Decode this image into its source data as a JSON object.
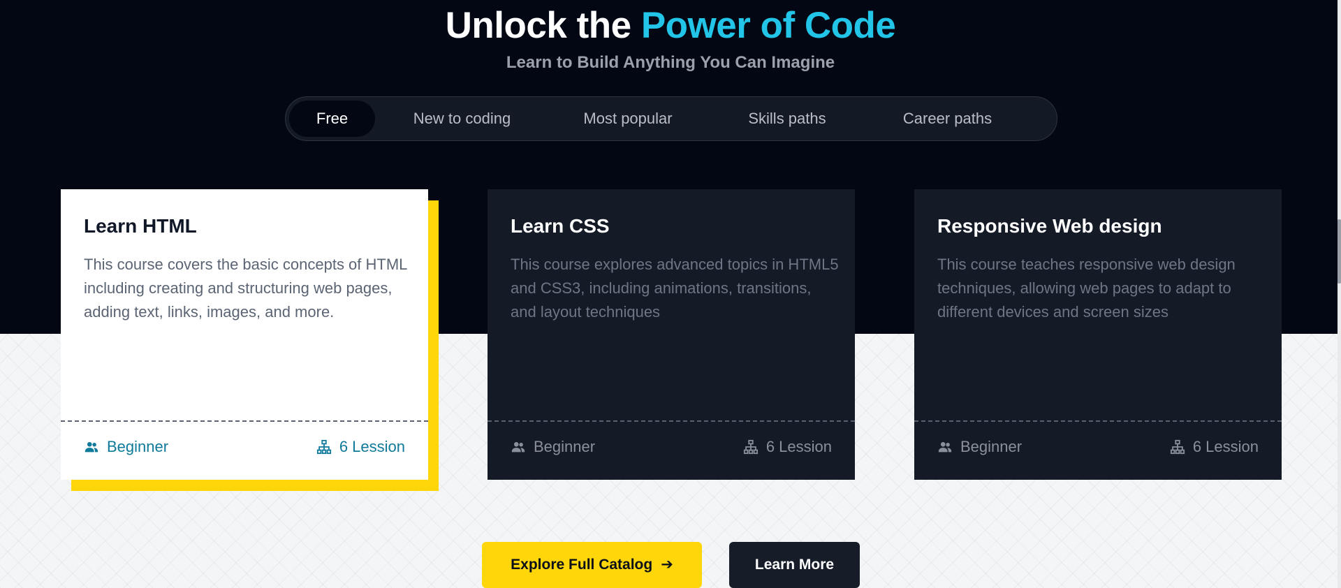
{
  "hero": {
    "title_plain": "Unlock the ",
    "title_accent": "Power of Code",
    "subtitle": "Learn to Build Anything You Can Imagine"
  },
  "tabs": [
    {
      "label": "Free",
      "active": true
    },
    {
      "label": "New to coding",
      "active": false
    },
    {
      "label": "Most popular",
      "active": false
    },
    {
      "label": "Skills paths",
      "active": false
    },
    {
      "label": "Career paths",
      "active": false
    }
  ],
  "cards": [
    {
      "title": "Learn HTML",
      "description": "This course covers the basic concepts of HTML including creating and structuring web pages, adding text, links, images, and more.",
      "level": "Beginner",
      "lessons": "6 Lession",
      "level_icon": "users-icon",
      "lessons_icon": "sitemap-icon"
    },
    {
      "title": "Learn CSS",
      "description": "This course explores advanced topics in HTML5 and CSS3, including animations, transitions, and layout techniques",
      "level": "Beginner",
      "lessons": "6 Lession",
      "level_icon": "users-icon",
      "lessons_icon": "sitemap-icon"
    },
    {
      "title": "Responsive Web design",
      "description": "This course teaches responsive web design techniques, allowing web pages to adapt to different devices and screen sizes",
      "level": "Beginner",
      "lessons": "6 Lession",
      "level_icon": "users-icon",
      "lessons_icon": "sitemap-icon"
    }
  ],
  "buttons": {
    "explore_label": "Explore Full Catalog",
    "explore_icon": "arrow-right-icon",
    "learn_more_label": "Learn More"
  },
  "colors": {
    "background_dark": "#020713",
    "accent_cyan": "#22c4e7",
    "accent_yellow": "#ffd60a",
    "card_dark": "#141a26"
  }
}
